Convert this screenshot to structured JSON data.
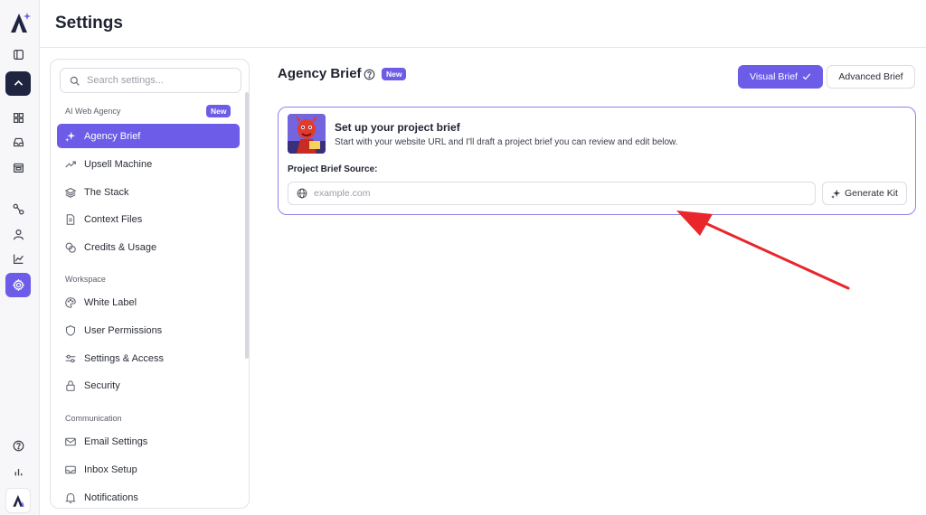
{
  "header": {
    "title": "Settings"
  },
  "search": {
    "placeholder": "Search settings..."
  },
  "nav": {
    "groups": [
      {
        "label": "AI Web Agency",
        "badge": "New"
      },
      {
        "label": "Workspace"
      },
      {
        "label": "Communication"
      }
    ],
    "items": [
      {
        "label": "Agency Brief",
        "icon": "sparkles-icon",
        "active": true
      },
      {
        "label": "Upsell Machine",
        "icon": "trend-up-icon"
      },
      {
        "label": "The Stack",
        "icon": "layers-icon"
      },
      {
        "label": "Context Files",
        "icon": "file-icon"
      },
      {
        "label": "Credits & Usage",
        "icon": "coins-icon"
      },
      {
        "label": "White Label",
        "icon": "palette-icon"
      },
      {
        "label": "User Permissions",
        "icon": "shield-icon"
      },
      {
        "label": "Settings & Access",
        "icon": "sliders-icon"
      },
      {
        "label": "Security",
        "icon": "lock-icon"
      },
      {
        "label": "Email Settings",
        "icon": "mail-icon"
      },
      {
        "label": "Inbox Setup",
        "icon": "inbox-icon"
      },
      {
        "label": "Notifications",
        "icon": "bell-icon"
      }
    ]
  },
  "main": {
    "title": "Agency Brief",
    "title_badge": "New",
    "tabs": [
      {
        "label": "Visual Brief",
        "selected": true
      },
      {
        "label": "Advanced Brief",
        "selected": false
      }
    ],
    "card": {
      "title": "Set up your project brief",
      "subtitle": "Start with your website URL and I'll draft a project brief you can review and edit below.",
      "field_label": "Project Brief Source:",
      "url_placeholder": "example.com",
      "url_value": "",
      "generate_label": "Generate Kit"
    }
  },
  "colors": {
    "accent": "#6c5ce7",
    "rail_dark": "#1f2540",
    "annotation_arrow": "#e8262b"
  }
}
